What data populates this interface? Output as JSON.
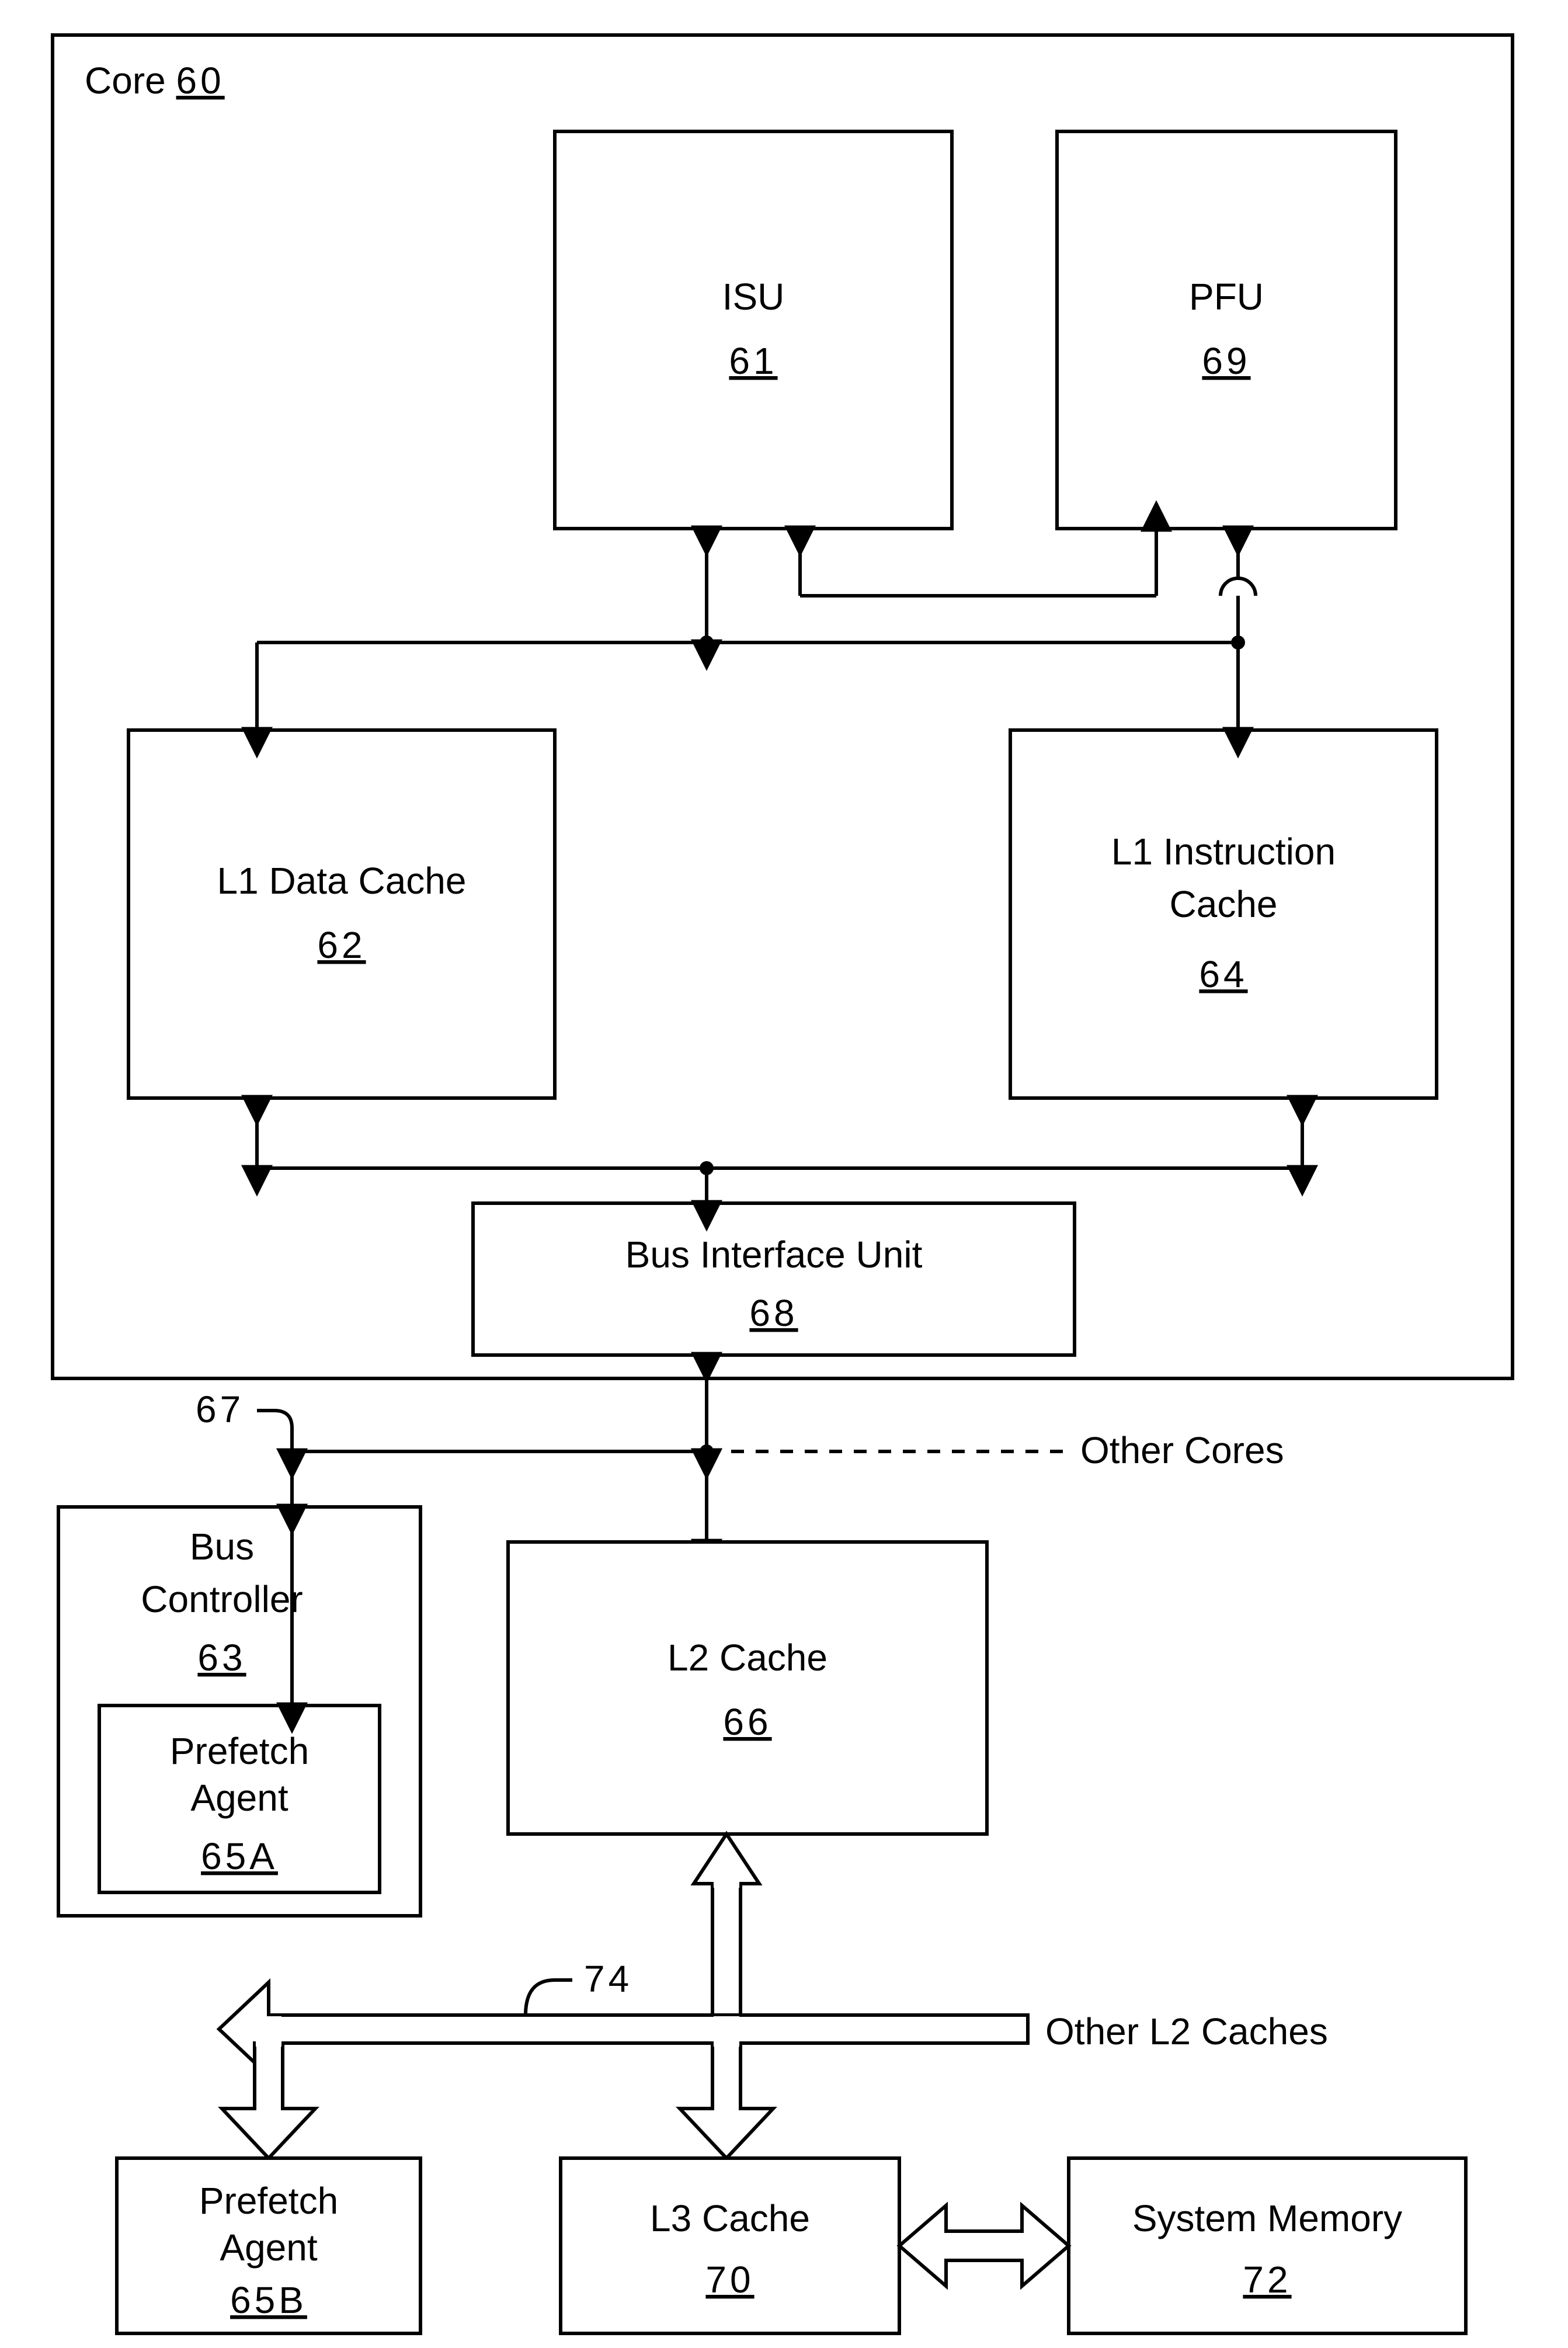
{
  "core": {
    "label": "Core",
    "num": "60"
  },
  "isu": {
    "label": "ISU",
    "num": "61"
  },
  "pfu": {
    "label": "PFU",
    "num": "69"
  },
  "l1d": {
    "label": "L1 Data Cache",
    "num": "62"
  },
  "l1i": {
    "label1": "L1 Instruction",
    "label2": "Cache",
    "num": "64"
  },
  "biu": {
    "label": "Bus Interface Unit",
    "num": "68"
  },
  "busCtl": {
    "label1": "Bus",
    "label2": "Controller",
    "num": "63"
  },
  "pfA": {
    "label1": "Prefetch",
    "label2": "Agent",
    "num": "65A"
  },
  "l2": {
    "label": "L2 Cache",
    "num": "66"
  },
  "pfB": {
    "label1": "Prefetch",
    "label2": "Agent",
    "num": "65B"
  },
  "l3": {
    "label": "L3 Cache",
    "num": "70"
  },
  "sysmem": {
    "label": "System Memory",
    "num": "72"
  },
  "otherCores": "Other Cores",
  "otherL2": "Other L2 Caches",
  "ref67": "67",
  "ref74": "74"
}
